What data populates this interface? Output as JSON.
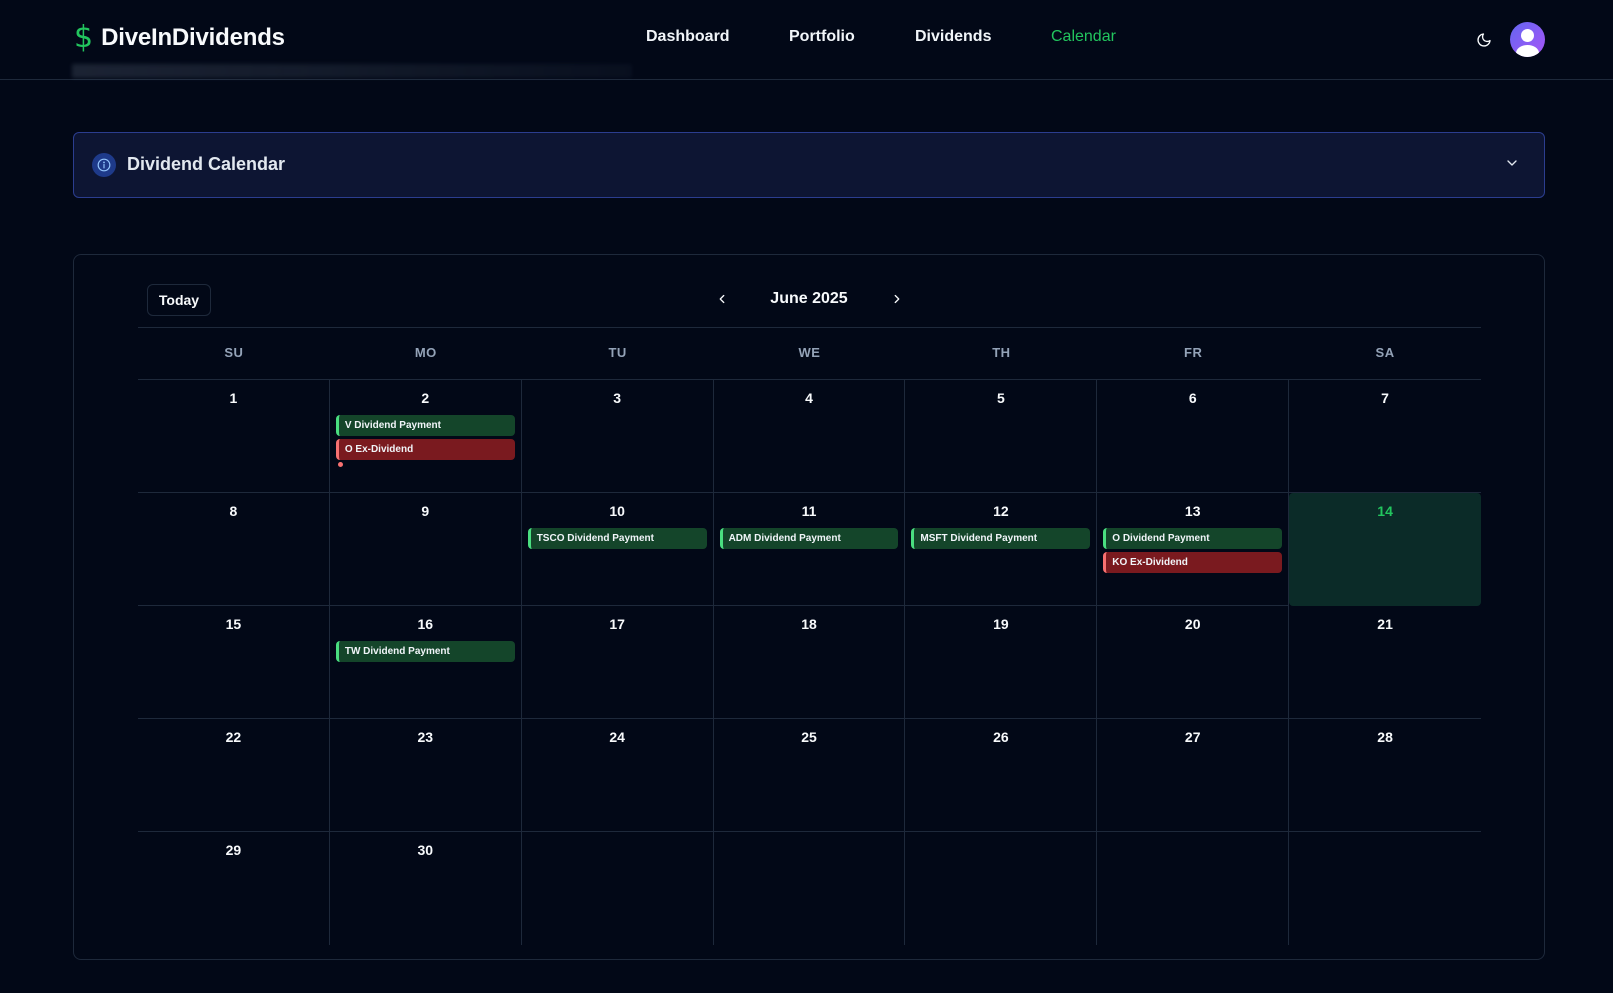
{
  "header": {
    "brand": "DiveInDividends",
    "brand_icon": "dollar-icon",
    "nav": [
      {
        "label": "Dashboard",
        "active": false
      },
      {
        "label": "Portfolio",
        "active": false
      },
      {
        "label": "Dividends",
        "active": false
      },
      {
        "label": "Calendar",
        "active": true
      }
    ],
    "theme_icon": "moon-icon",
    "avatar_icon": "user-avatar-icon"
  },
  "banner": {
    "title": "Dividend Calendar",
    "icon": "info-icon",
    "toggle_icon": "chevron-down-icon"
  },
  "calendar": {
    "today_label": "Today",
    "month": "June 2025",
    "weekdays": [
      "SU",
      "MO",
      "TU",
      "WE",
      "TH",
      "FR",
      "SA"
    ],
    "today_day": "14",
    "weeks": [
      [
        {
          "day": "1",
          "events": []
        },
        {
          "day": "2",
          "events": [
            {
              "label": "V Dividend Payment",
              "kind": "pay"
            },
            {
              "label": "O Ex-Dividend",
              "kind": "ex"
            }
          ],
          "more": true
        },
        {
          "day": "3",
          "events": []
        },
        {
          "day": "4",
          "events": []
        },
        {
          "day": "5",
          "events": []
        },
        {
          "day": "6",
          "events": []
        },
        {
          "day": "7",
          "events": []
        }
      ],
      [
        {
          "day": "8",
          "events": []
        },
        {
          "day": "9",
          "events": []
        },
        {
          "day": "10",
          "events": [
            {
              "label": "TSCO Dividend Payment",
              "kind": "pay"
            }
          ]
        },
        {
          "day": "11",
          "events": [
            {
              "label": "ADM Dividend Payment",
              "kind": "pay"
            }
          ]
        },
        {
          "day": "12",
          "events": [
            {
              "label": "MSFT Dividend Payment",
              "kind": "pay"
            }
          ]
        },
        {
          "day": "13",
          "events": [
            {
              "label": "O Dividend Payment",
              "kind": "pay"
            },
            {
              "label": "KO Ex-Dividend",
              "kind": "ex"
            }
          ]
        },
        {
          "day": "14",
          "events": []
        }
      ],
      [
        {
          "day": "15",
          "events": []
        },
        {
          "day": "16",
          "events": [
            {
              "label": "TW Dividend Payment",
              "kind": "pay"
            }
          ]
        },
        {
          "day": "17",
          "events": []
        },
        {
          "day": "18",
          "events": []
        },
        {
          "day": "19",
          "events": []
        },
        {
          "day": "20",
          "events": []
        },
        {
          "day": "21",
          "events": []
        }
      ],
      [
        {
          "day": "22",
          "events": []
        },
        {
          "day": "23",
          "events": []
        },
        {
          "day": "24",
          "events": []
        },
        {
          "day": "25",
          "events": []
        },
        {
          "day": "26",
          "events": []
        },
        {
          "day": "27",
          "events": []
        },
        {
          "day": "28",
          "events": []
        }
      ],
      [
        {
          "day": "29",
          "events": []
        },
        {
          "day": "30",
          "events": []
        },
        {
          "day": "",
          "events": []
        },
        {
          "day": "",
          "events": []
        },
        {
          "day": "",
          "events": []
        },
        {
          "day": "",
          "events": []
        },
        {
          "day": "",
          "events": []
        }
      ]
    ]
  },
  "colors": {
    "accent": "#22c55e",
    "background": "#020817",
    "payment": "#14452a",
    "ex_dividend": "#7a1a1f",
    "banner_bg": "#0d1533",
    "banner_border": "#2b3d8f"
  }
}
